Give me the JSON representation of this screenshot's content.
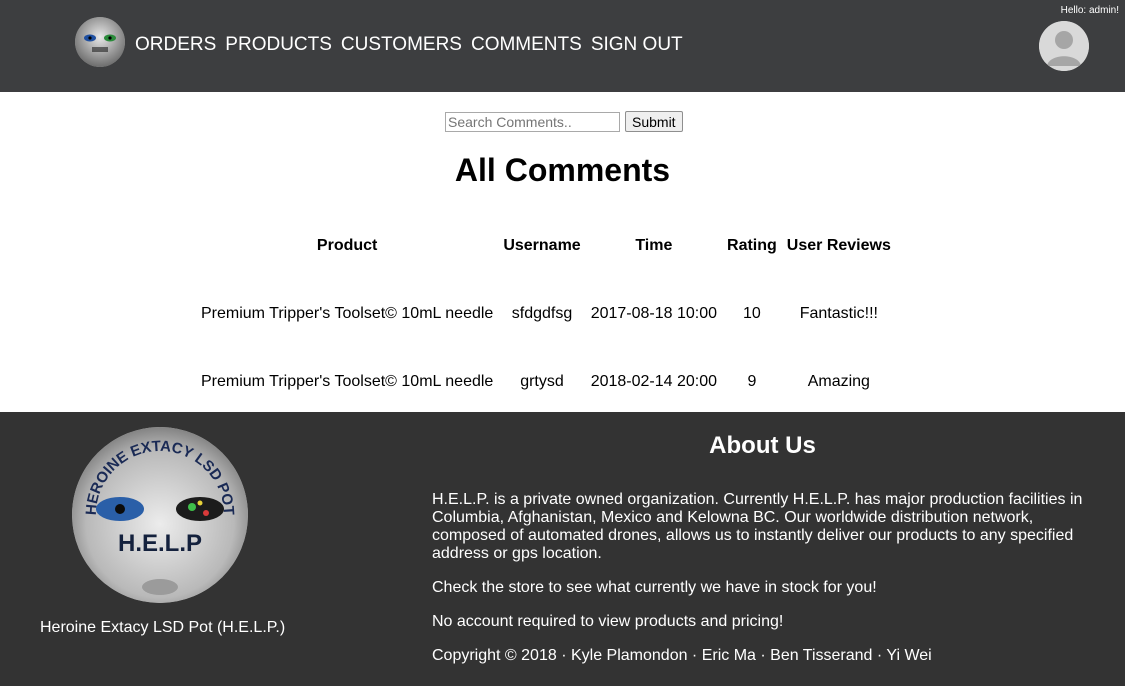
{
  "header": {
    "greeting": "Hello: admin!",
    "nav": [
      {
        "label": "ORDERS"
      },
      {
        "label": "PRODUCTS"
      },
      {
        "label": "CUSTOMERS"
      },
      {
        "label": "COMMENTS"
      },
      {
        "label": "SIGN OUT"
      }
    ],
    "logo_icon": "help-logo-icon",
    "avatar_icon": "user-avatar-icon"
  },
  "search": {
    "placeholder": "Search Comments..",
    "submit_label": "Submit"
  },
  "page_title": "All Comments",
  "table": {
    "headers": [
      "Product",
      "Username",
      "Time",
      "Rating",
      "User Reviews"
    ],
    "rows": [
      {
        "product": "Premium Tripper's Toolset© 10mL needle",
        "username": "sfdgdfsg",
        "time": "2017-08-18 10:00",
        "rating": "10",
        "review": "Fantastic!!!"
      },
      {
        "product": "Premium Tripper's Toolset© 10mL needle",
        "username": "grtysd",
        "time": "2018-02-14 20:00",
        "rating": "9",
        "review": "Amazing"
      }
    ]
  },
  "footer": {
    "logo_text_arc": "HEROINE EXTACY LSD POT",
    "logo_text_center": "H.E.L.P",
    "brand_caption": "Heroine Extacy LSD Pot (H.E.L.P.)",
    "about_title": "About Us",
    "paragraphs": [
      "H.E.L.P. is a private owned organization. Currently H.E.L.P. has major production facilities in Columbia, Afghanistan, Mexico and Kelowna BC. Our worldwide distribution network, composed of automated drones, allows us to instantly deliver our products to any specified address or gps location.",
      "Check the store to see what currently we have in stock for you!",
      "No account required to view products and pricing!",
      "Copyright © 2018 · Kyle Plamondon · Eric Ma · Ben Tisserand · Yi Wei"
    ]
  },
  "colors": {
    "header_bg": "#3d3e40",
    "footer_bg": "#333333",
    "nav_text": "#ffffff"
  }
}
